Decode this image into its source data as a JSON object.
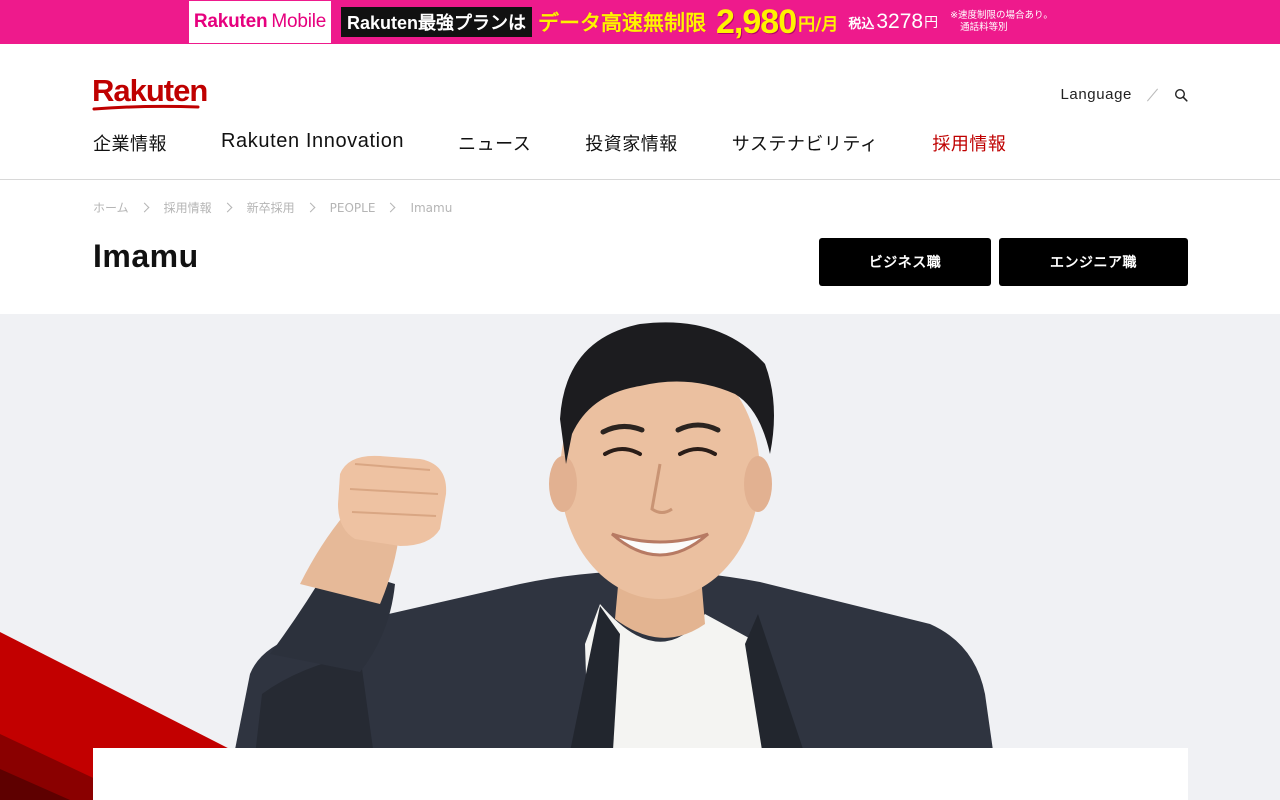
{
  "promo": {
    "logo_brand": "Rakuten",
    "logo_product": "Mobile",
    "plan_label": "Rakuten最強プランは",
    "data_label": "データ高速無制限",
    "price": "2,980",
    "price_unit": "円/月",
    "tax_label": "税込",
    "tax_amount": "3278",
    "tax_unit": "円",
    "note_line1": "※速度制限の場合あり。",
    "note_line2": "通話料等別"
  },
  "header": {
    "logo_text": "Rakuten",
    "language_label": "Language",
    "search_icon": "search-icon",
    "nav": [
      {
        "label": "企業情報",
        "active": false
      },
      {
        "label": "Rakuten Innovation",
        "active": false
      },
      {
        "label": "ニュース",
        "active": false
      },
      {
        "label": "投資家情報",
        "active": false
      },
      {
        "label": "サステナビリティ",
        "active": false
      },
      {
        "label": "採用情報",
        "active": true
      }
    ]
  },
  "breadcrumb": [
    "ホーム",
    "採用情報",
    "新卒採用",
    "PEOPLE",
    "Imamu"
  ],
  "page": {
    "title": "Imamu",
    "business_button": "ビジネス職",
    "engineer_button": "エンジニア職"
  },
  "colors": {
    "brand_red": "#bf0000",
    "promo_pink": "#ee1a8c",
    "promo_yellow": "#fff200",
    "button_black": "#000000"
  }
}
